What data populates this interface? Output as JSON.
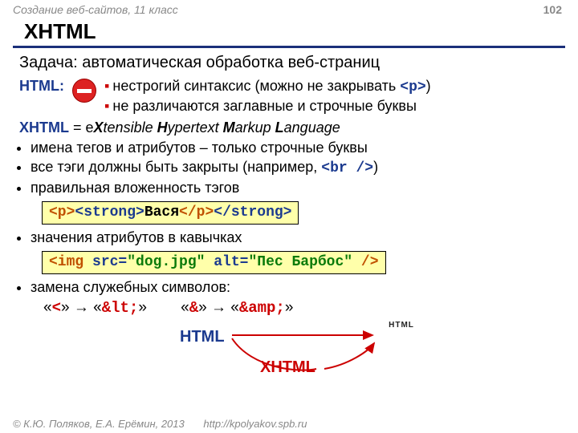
{
  "header": {
    "course": "Создание веб-сайтов, 11 класс",
    "page_num": "102",
    "title": "XHTML"
  },
  "task": "Задача: автоматическая обработка веб-страниц",
  "html_label": "HTML:",
  "html_points": {
    "p1_a": "нестрогий синтаксис (можно не закрывать ",
    "p1_b": "<p>",
    "p1_c": ")",
    "p2": "не различаются заглавные и строчные буквы"
  },
  "xhtml_def": {
    "label": "XHTML",
    "eq": " = e",
    "x": "X",
    "t1": "tensible ",
    "h": "H",
    "t2": "ypertext ",
    "m": "M",
    "t3": "arkup ",
    "l": "L",
    "t4": "anguage"
  },
  "rules": {
    "r1": "имена тегов и атрибутов – только строчные буквы",
    "r2_a": "все тэги должны быть закрыты (например, ",
    "r2_b": "<br />",
    "r2_c": ")",
    "r3": "правильная вложенность тэгов",
    "r4": "значения атрибутов в кавычках",
    "r5": "замена служебных символов:"
  },
  "code1": {
    "p_open": "<p>",
    "strong_open": "<strong>",
    "text": "Вася",
    "p_close": "</p>",
    "strong_close": "</strong>"
  },
  "code2": {
    "img_open": "<img ",
    "src_attr": "src=",
    "src_val": "\"dog.jpg\"",
    "alt_attr": " alt=",
    "alt_val": "\"Пес Барбос\"",
    "close": " />"
  },
  "entities": {
    "lt_char": "<",
    "lt_ent": "&lt;",
    "amp_char": "&",
    "amp_ent": "&amp;",
    "arrow": " → ",
    "q": "«",
    "qc": "»"
  },
  "diagram": {
    "html": "HTML",
    "xhtml": "XHTML",
    "logo_text": "HTML"
  },
  "footer": {
    "copy": "© К.Ю. Поляков, Е.А. Ерёмин, 2013",
    "url": "http://kpolyakov.spb.ru"
  }
}
